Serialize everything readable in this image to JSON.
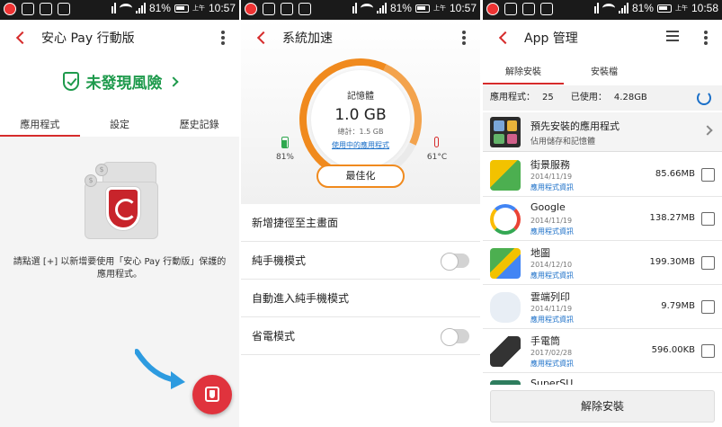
{
  "statusbars": [
    {
      "battery": "81%",
      "ampm": "上午",
      "time": "10:57"
    },
    {
      "battery": "81%",
      "ampm": "上午",
      "time": "10:57"
    },
    {
      "battery": "81%",
      "ampm": "上午",
      "time": "10:58"
    }
  ],
  "panel1": {
    "title": "安心 Pay 行動版",
    "status": "未發現風險",
    "tabs": [
      "應用程式",
      "設定",
      "歷史記錄"
    ],
    "description": "請點選 [+] 以新增要使用「安心 Pay 行動版」保護的應用程式。",
    "colors": {
      "accent": "#d62b2b",
      "safe": "#1e9a4c",
      "fab": "#e0333d"
    }
  },
  "panel2": {
    "title": "系統加速",
    "memory_label": "記憶體",
    "memory_value": "1.0 GB",
    "memory_total": "總計：1.5 GB",
    "running_apps_link": "使用中的應用程式",
    "battery": "81%",
    "temperature": "61°C",
    "optimize_button": "最佳化",
    "rows": [
      {
        "label": "新增捷徑至主畫面",
        "toggle": false
      },
      {
        "label": "純手機模式",
        "toggle": true
      },
      {
        "label": "自動進入純手機模式",
        "toggle": false
      },
      {
        "label": "省電模式",
        "toggle": true
      }
    ],
    "colors": {
      "gauge": "#f08a1e"
    }
  },
  "panel3": {
    "title": "App 管理",
    "tabs": [
      "解除安裝",
      "安裝檔"
    ],
    "summary": {
      "apps_label": "應用程式：",
      "apps_count": "25",
      "used_label": "已使用：",
      "used_value": "4.28GB"
    },
    "preinstalled": {
      "title": "預先安裝的應用程式",
      "subtitle": "佔用儲存和記憶體"
    },
    "apps": [
      {
        "name": "街景服務",
        "date": "2014/11/19",
        "link": "應用程式資訊",
        "size": "85.66MB",
        "icon": "street-view-icon"
      },
      {
        "name": "Google",
        "date": "2014/11/19",
        "link": "應用程式資訊",
        "size": "138.27MB",
        "icon": "google-icon"
      },
      {
        "name": "地圖",
        "date": "2014/12/10",
        "link": "應用程式資訊",
        "size": "199.30MB",
        "icon": "maps-icon"
      },
      {
        "name": "雲端列印",
        "date": "2014/11/19",
        "link": "應用程式資訊",
        "size": "9.79MB",
        "icon": "cloud-print-icon"
      },
      {
        "name": "手電筒",
        "date": "2017/02/28",
        "link": "應用程式資訊",
        "size": "596.00KB",
        "icon": "flashlight-icon"
      },
      {
        "name": "SuperSU",
        "date": "",
        "link": "",
        "size": "",
        "icon": "supersu-icon"
      }
    ],
    "uninstall_button": "解除安裝"
  }
}
